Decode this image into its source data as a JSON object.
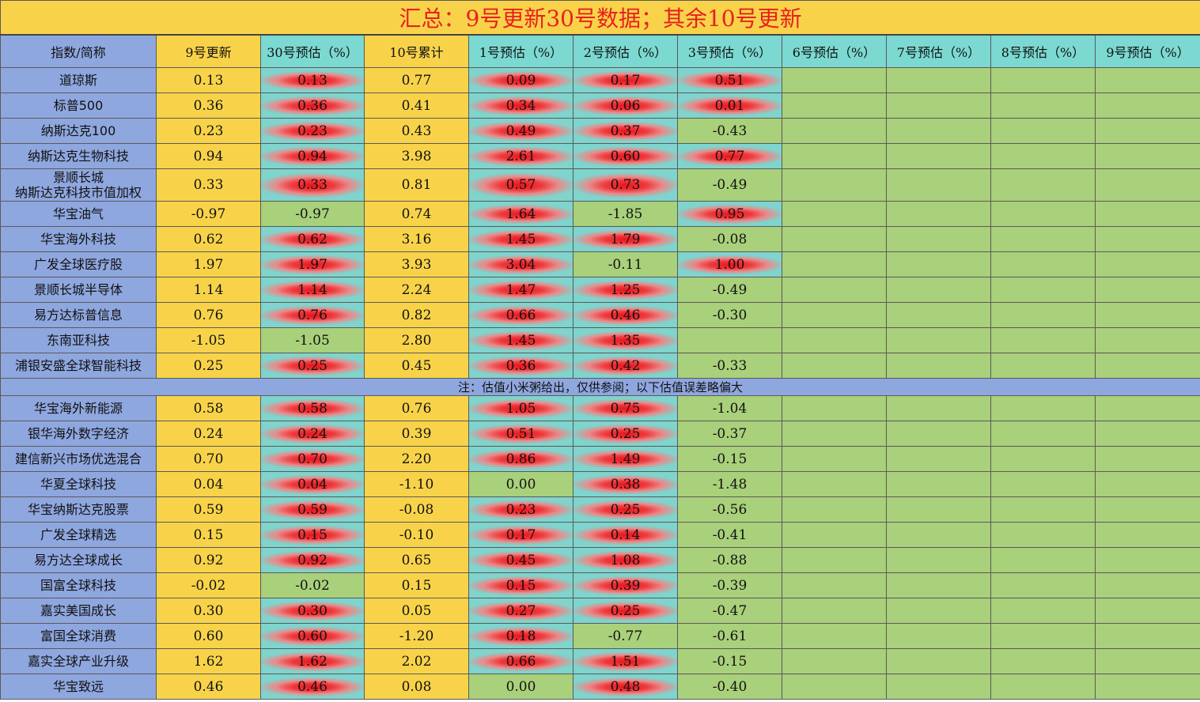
{
  "title": "汇总：9号更新30号数据；其余10号更新",
  "headers": [
    "指数/简称",
    "9号更新",
    "30号预估（%）",
    "10号累计",
    "1号预估（%）",
    "2号预估（%）",
    "3号预估（%）",
    "6号预估（%）",
    "7号预估（%）",
    "8号预估（%）",
    "9号预估（%）"
  ],
  "note": "注：估值小米粥给出，仅供参阅；以下估值误差略偏大",
  "colors": {
    "name_bg": "#8fa7df",
    "yellow_bg": "#f8d34a",
    "cyan_bg": "#7bd9d1",
    "green_bg": "#a9d07a",
    "up_red": "#e8141c",
    "title_red": "#e8201f"
  },
  "rows_top": [
    {
      "name": "道琼斯",
      "v9": "0.13",
      "p30": "0.13",
      "c10": "0.77",
      "p1": "0.09",
      "p2": "0.17",
      "p3": "0.51"
    },
    {
      "name": "标普500",
      "v9": "0.36",
      "p30": "0.36",
      "c10": "0.41",
      "p1": "0.34",
      "p2": "0.06",
      "p3": "0.01"
    },
    {
      "name": "纳斯达克100",
      "v9": "0.23",
      "p30": "0.23",
      "c10": "0.43",
      "p1": "0.49",
      "p2": "0.37",
      "p3": "-0.43"
    },
    {
      "name": "纳斯达克生物科技",
      "v9": "0.94",
      "p30": "0.94",
      "c10": "3.98",
      "p1": "2.61",
      "p2": "0.60",
      "p3": "0.77"
    },
    {
      "name": "景顺长城\n纳斯达克科技市值加权",
      "v9": "0.33",
      "p30": "0.33",
      "c10": "0.81",
      "p1": "0.57",
      "p2": "0.73",
      "p3": "-0.49"
    },
    {
      "name": "华宝油气",
      "v9": "-0.97",
      "p30": "-0.97",
      "c10": "0.74",
      "p1": "1.64",
      "p2": "-1.85",
      "p3": "0.95"
    },
    {
      "name": "华宝海外科技",
      "v9": "0.62",
      "p30": "0.62",
      "c10": "3.16",
      "p1": "1.45",
      "p2": "1.79",
      "p3": "-0.08"
    },
    {
      "name": "广发全球医疗股",
      "v9": "1.97",
      "p30": "1.97",
      "c10": "3.93",
      "p1": "3.04",
      "p2": "-0.11",
      "p3": "1.00"
    },
    {
      "name": "景顺长城半导体",
      "v9": "1.14",
      "p30": "1.14",
      "c10": "2.24",
      "p1": "1.47",
      "p2": "1.25",
      "p3": "-0.49"
    },
    {
      "name": "易方达标普信息",
      "v9": "0.76",
      "p30": "0.76",
      "c10": "0.82",
      "p1": "0.66",
      "p2": "0.46",
      "p3": "-0.30"
    },
    {
      "name": "东南亚科技",
      "v9": "-1.05",
      "p30": "-1.05",
      "c10": "2.80",
      "p1": "1.45",
      "p2": "1.35",
      "p3": ""
    },
    {
      "name": "浦银安盛全球智能科技",
      "v9": "0.25",
      "p30": "0.25",
      "c10": "0.45",
      "p1": "0.36",
      "p2": "0.42",
      "p3": "-0.33"
    }
  ],
  "rows_bottom": [
    {
      "name": "华宝海外新能源",
      "v9": "0.58",
      "p30": "0.58",
      "c10": "0.76",
      "p1": "1.05",
      "p2": "0.75",
      "p3": "-1.04"
    },
    {
      "name": "银华海外数字经济",
      "v9": "0.24",
      "p30": "0.24",
      "c10": "0.39",
      "p1": "0.51",
      "p2": "0.25",
      "p3": "-0.37"
    },
    {
      "name": "建信新兴市场优选混合",
      "v9": "0.70",
      "p30": "0.70",
      "c10": "2.20",
      "p1": "0.86",
      "p2": "1.49",
      "p3": "-0.15"
    },
    {
      "name": "华夏全球科技",
      "v9": "0.04",
      "p30": "0.04",
      "c10": "-1.10",
      "p1": "0.00",
      "p2": "0.38",
      "p3": "-1.48"
    },
    {
      "name": "华宝纳斯达克股票",
      "v9": "0.59",
      "p30": "0.59",
      "c10": "-0.08",
      "p1": "0.23",
      "p2": "0.25",
      "p3": "-0.56"
    },
    {
      "name": "广发全球精选",
      "v9": "0.15",
      "p30": "0.15",
      "c10": "-0.10",
      "p1": "0.17",
      "p2": "0.14",
      "p3": "-0.41"
    },
    {
      "name": "易方达全球成长",
      "v9": "0.92",
      "p30": "0.92",
      "c10": "0.65",
      "p1": "0.45",
      "p2": "1.08",
      "p3": "-0.88"
    },
    {
      "name": "国富全球科技",
      "v9": "-0.02",
      "p30": "-0.02",
      "c10": "0.15",
      "p1": "0.15",
      "p2": "0.39",
      "p3": "-0.39"
    },
    {
      "name": "嘉实美国成长",
      "v9": "0.30",
      "p30": "0.30",
      "c10": "0.05",
      "p1": "0.27",
      "p2": "0.25",
      "p3": "-0.47"
    },
    {
      "name": "富国全球消费",
      "v9": "0.60",
      "p30": "0.60",
      "c10": "-1.20",
      "p1": "0.18",
      "p2": "-0.77",
      "p3": "-0.61"
    },
    {
      "name": "嘉实全球产业升级",
      "v9": "1.62",
      "p30": "1.62",
      "c10": "2.02",
      "p1": "0.66",
      "p2": "1.51",
      "p3": "-0.15"
    },
    {
      "name": "华宝致远",
      "v9": "0.46",
      "p30": "0.46",
      "c10": "0.08",
      "p1": "0.00",
      "p2": "0.48",
      "p3": "-0.40"
    }
  ]
}
